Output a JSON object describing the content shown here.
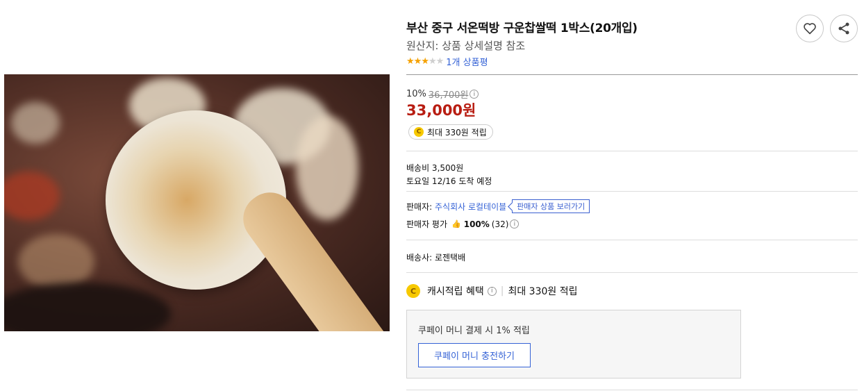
{
  "product": {
    "title": "부산 중구 서온떡방 구운찹쌀떡 1박스(20개입)",
    "origin": "원산지: 상품 상세설명 참조",
    "rating_stars": 3,
    "rating_max": 5,
    "review_link": "1개 상품평"
  },
  "actions": {
    "wish_icon": "heart-icon",
    "share_icon": "share-icon"
  },
  "price": {
    "discount": "10%",
    "original": "36,700원",
    "sale": "33,000원",
    "points": "최대 330원 적립"
  },
  "shipping": {
    "fee": "배송비 3,500원",
    "arrival": "토요일 12/16 도착 예정",
    "carrier": "배송사: 로젠택배"
  },
  "seller": {
    "label": "판매자:",
    "name": "주식회사 로컬테이블",
    "shop_button": "판매자 상품 보러가기",
    "rating_label": "판매자 평가",
    "rating_value": "100%",
    "rating_count": "(32)"
  },
  "cash": {
    "label": "캐시적립 혜택",
    "value": "최대 330원 적립"
  },
  "coupay": {
    "text": "쿠페이 머니 결제 시 1% 적립",
    "button": "쿠페이 머니 충전하기"
  },
  "colors": {
    "sale_price": "#b81d12",
    "link": "#3462d6",
    "star": "#f5a100",
    "coin": "#f7c900"
  }
}
